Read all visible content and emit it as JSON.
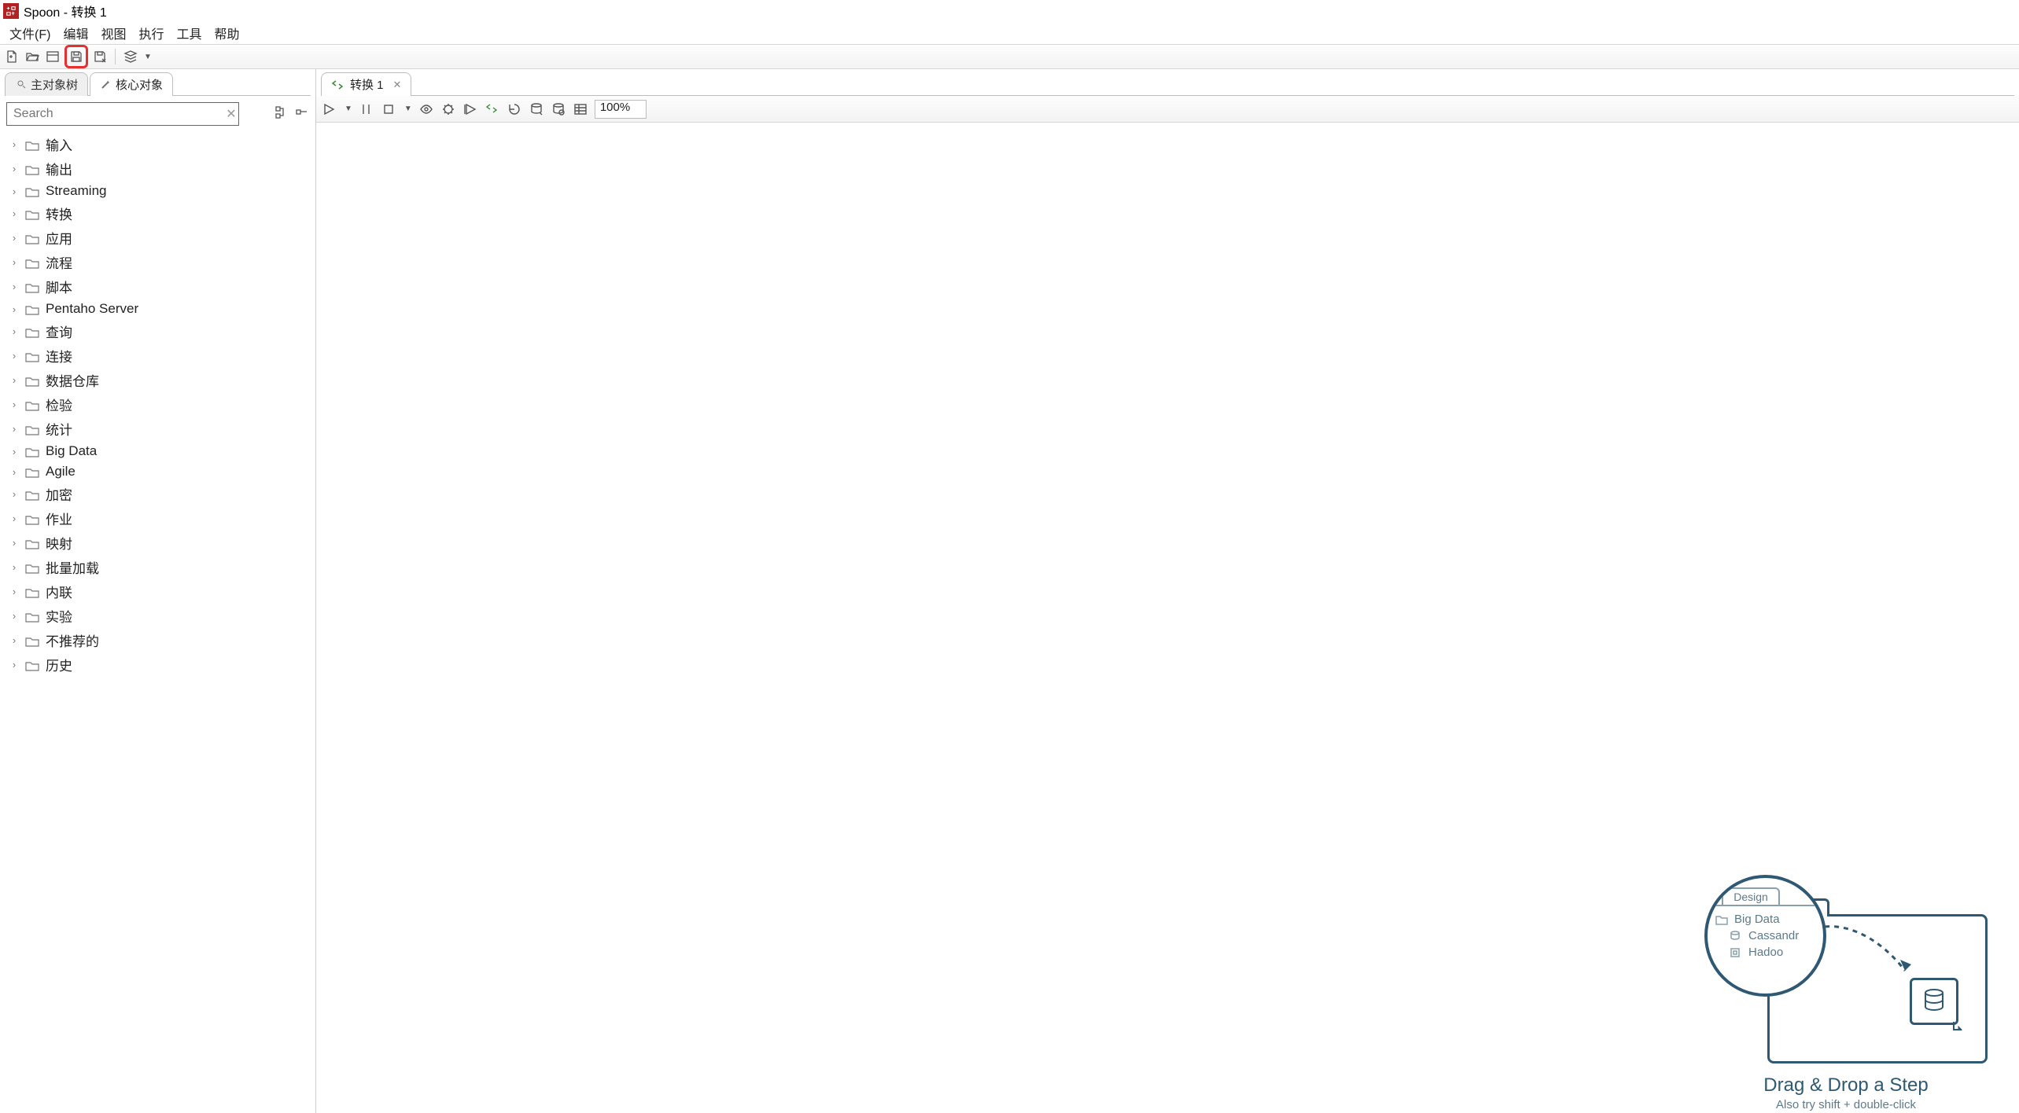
{
  "title": "Spoon - 转换 1",
  "menu": {
    "file": "文件(F)",
    "edit": "编辑",
    "view": "视图",
    "run": "执行",
    "tools": "工具",
    "help": "帮助"
  },
  "side_tabs": {
    "main_tree": "主对象树",
    "core_objects": "核心对象"
  },
  "search": {
    "placeholder": "Search"
  },
  "tree_items": [
    {
      "label": "输入"
    },
    {
      "label": "输出"
    },
    {
      "label": "Streaming"
    },
    {
      "label": "转换"
    },
    {
      "label": "应用"
    },
    {
      "label": "流程"
    },
    {
      "label": "脚本"
    },
    {
      "label": "Pentaho Server"
    },
    {
      "label": "查询"
    },
    {
      "label": "连接"
    },
    {
      "label": "数据仓库"
    },
    {
      "label": "检验"
    },
    {
      "label": "统计"
    },
    {
      "label": "Big Data"
    },
    {
      "label": "Agile"
    },
    {
      "label": "加密"
    },
    {
      "label": "作业"
    },
    {
      "label": "映射"
    },
    {
      "label": "批量加载"
    },
    {
      "label": "内联"
    },
    {
      "label": "实验"
    },
    {
      "label": "不推荐的"
    },
    {
      "label": "历史"
    }
  ],
  "editor_tab": {
    "label": "转换 1"
  },
  "zoom": "100%",
  "hint": {
    "lens_tab": "Design",
    "lens_folder": "Big Data",
    "lens_item1": "Cassandr",
    "lens_item2": "Hadoo",
    "title": "Drag & Drop a Step",
    "subtitle": "Also try shift + double-click"
  }
}
